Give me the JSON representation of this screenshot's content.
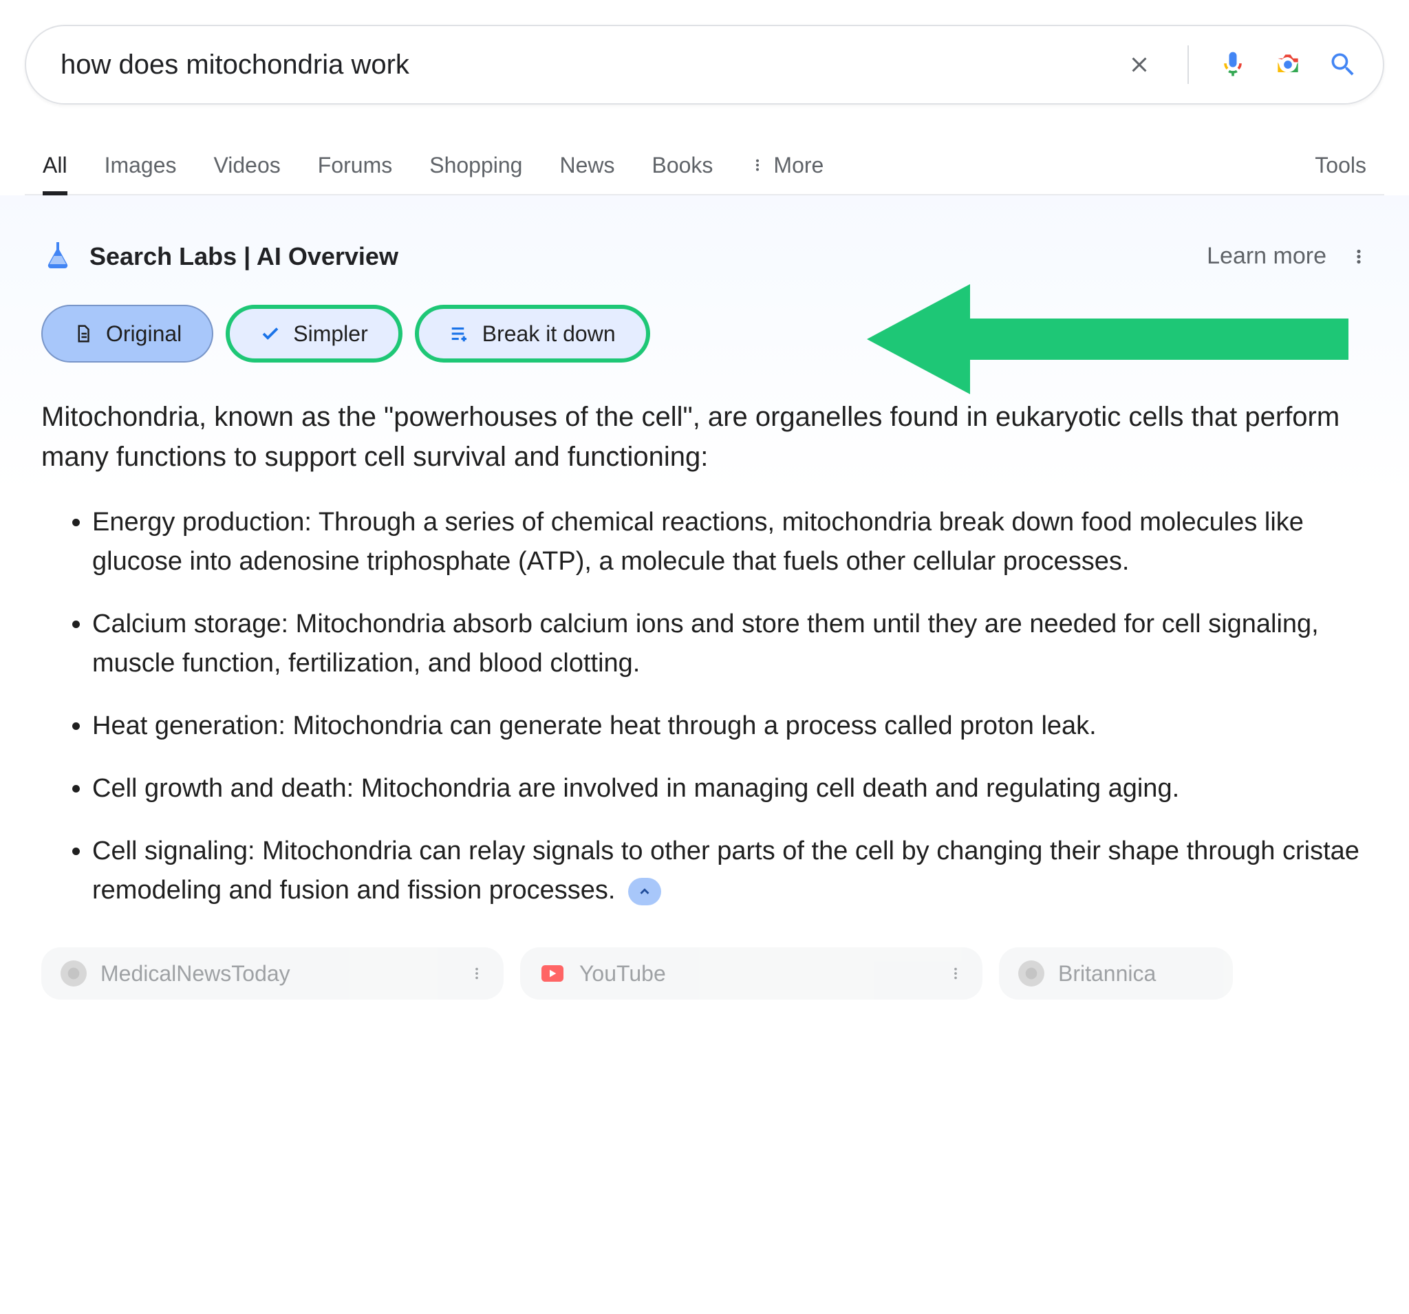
{
  "search": {
    "query": "how does mitochondria work"
  },
  "tabs": {
    "items": [
      "All",
      "Images",
      "Videos",
      "Forums",
      "Shopping",
      "News",
      "Books"
    ],
    "more": "More",
    "tools": "Tools",
    "active_index": 0
  },
  "ai": {
    "title": "Search Labs | AI Overview",
    "learn_more": "Learn more",
    "chips": {
      "original": "Original",
      "simpler": "Simpler",
      "break": "Break it down"
    },
    "paragraph": "Mitochondria, known as the \"powerhouses of the cell\", are organelles found in eukaryotic cells that perform many functions to support cell survival and functioning:",
    "bullets": [
      "Energy production: Through a series of chemical reactions, mitochondria break down food molecules like glucose into adenosine triphosphate (ATP), a molecule that fuels other cellular processes.",
      "Calcium storage: Mitochondria absorb calcium ions and store them until they are needed for cell signaling, muscle function, fertilization, and blood clotting.",
      "Heat generation: Mitochondria can generate heat through a process called proton leak.",
      "Cell growth and death: Mitochondria are involved in managing cell death and regulating aging.",
      "Cell signaling: Mitochondria can relay signals to other parts of the cell by changing their shape through cristae remodeling and fusion and fission processes."
    ]
  },
  "sources": [
    {
      "name": "MedicalNewsToday"
    },
    {
      "name": "YouTube"
    },
    {
      "name": "Britannica"
    }
  ],
  "annotation": {
    "arrow_color": "#1ec776"
  }
}
